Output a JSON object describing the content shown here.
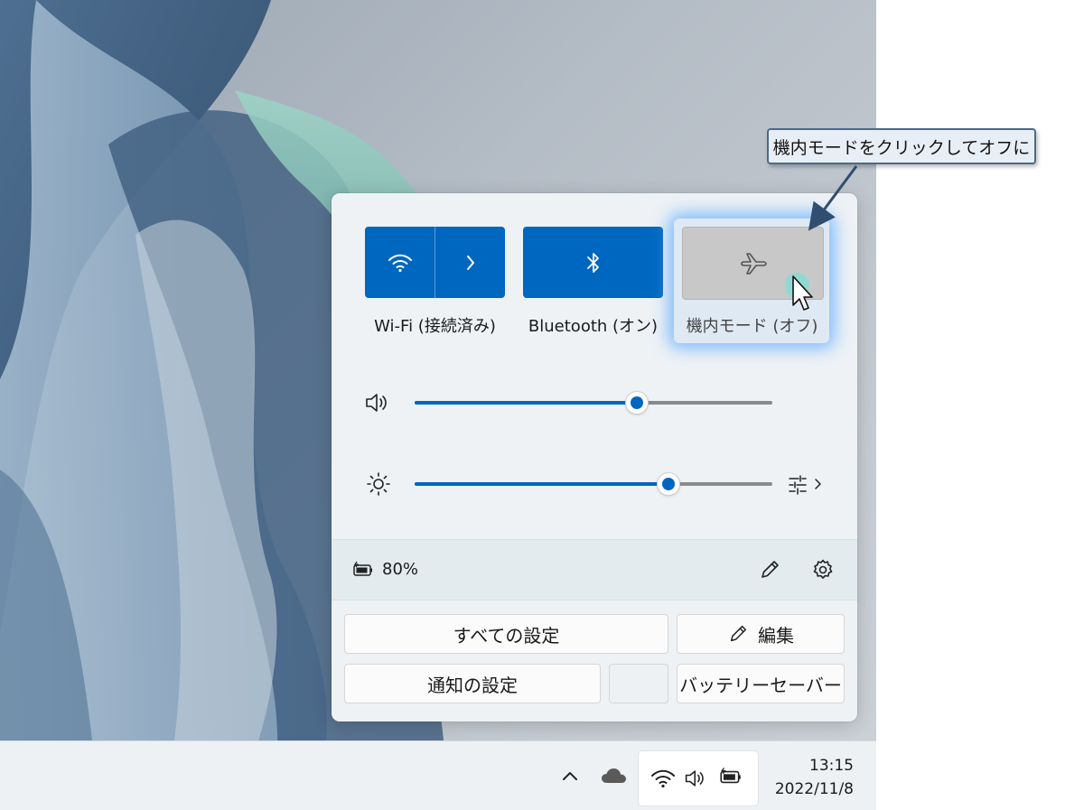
{
  "callout": {
    "text": "機内モードをクリックしてオフに"
  },
  "quick_settings": {
    "tiles": [
      {
        "label": "Wi-Fi (接続済み)",
        "state": "on",
        "icon": "wifi-icon"
      },
      {
        "label": "Bluetooth (オン)",
        "state": "on",
        "icon": "bluetooth-icon"
      },
      {
        "label": "機内モード (オフ)",
        "state": "off",
        "icon": "airplane-icon"
      }
    ],
    "volume": {
      "icon": "speaker-icon",
      "level": 0.62
    },
    "brightness": {
      "icon": "sun-icon",
      "level": 0.71
    },
    "battery": {
      "icon": "battery-charging-icon",
      "percent": "80%"
    }
  },
  "buttons": {
    "all_settings": "すべての設定",
    "edit": "編集",
    "notification_settings": "通知の設定",
    "battery_saver": "バッテリーセーバー"
  },
  "taskbar": {
    "time": "13:15",
    "date": "2022/11/8"
  },
  "colors": {
    "accent": "#0067c0",
    "tile_off": "#c8c8c8",
    "callout_border": "#4a6a8c"
  }
}
